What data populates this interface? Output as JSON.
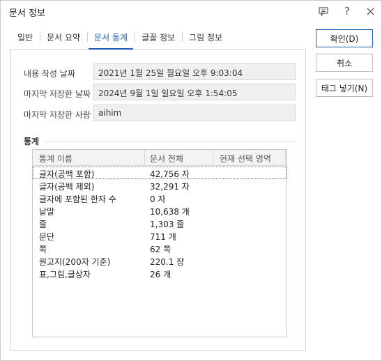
{
  "window": {
    "title": "문서 정보"
  },
  "titlebar_icons": [
    "comment-icon",
    "help-icon",
    "close-icon"
  ],
  "tabs": [
    {
      "label": "일반",
      "active": false
    },
    {
      "label": "문서 요약",
      "active": false
    },
    {
      "label": "문서 통계",
      "active": true
    },
    {
      "label": "글꼴 정보",
      "active": false
    },
    {
      "label": "그림 정보",
      "active": false
    }
  ],
  "info": {
    "created_label": "내용 작성 날짜",
    "created_value": "2021년 1월 25일 월요일 오후 9:03:04",
    "saved_label": "마지막 저장한 날짜",
    "saved_value": "2024년 9월 1일 일요일 오후 1:54:05",
    "saver_label": "마지막 저장한 사람",
    "saver_value": "aihim"
  },
  "stats": {
    "section_title": "통계",
    "columns": [
      "통계 이름",
      "문서 전체",
      "현재 선택 영역"
    ],
    "rows": [
      {
        "name": "글자(공백 포함)",
        "value": "42,756 자"
      },
      {
        "name": "글자(공백 제외)",
        "value": "32,291 자"
      },
      {
        "name": "글자에 포함된 한자 수",
        "value": "0 자"
      },
      {
        "name": "낱말",
        "value": "10,638 개"
      },
      {
        "name": "줄",
        "value": "1,303 줄"
      },
      {
        "name": "문단",
        "value": "711 개"
      },
      {
        "name": "쪽",
        "value": "62 쪽"
      },
      {
        "name": "원고지(200자 기준)",
        "value": "220.1 장"
      },
      {
        "name": "표,그림,글상자",
        "value": "26 개"
      }
    ]
  },
  "buttons": {
    "ok": "확인(D)",
    "cancel": "취소",
    "insert_tag": "태그 넣기(N)"
  },
  "colors": {
    "accent": "#1f5fbf"
  }
}
